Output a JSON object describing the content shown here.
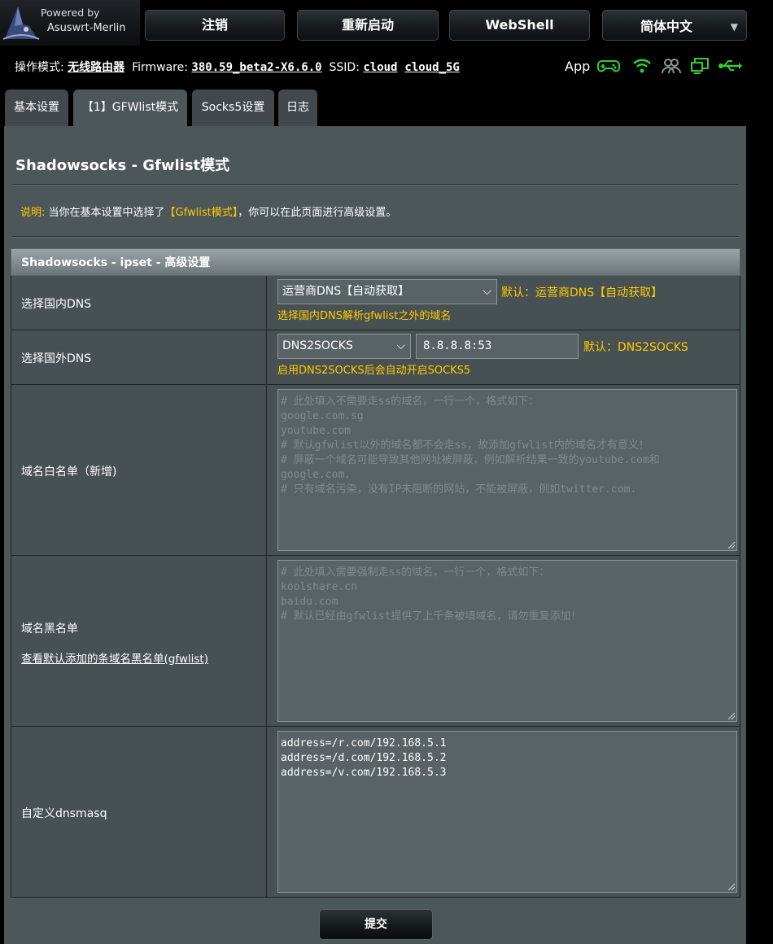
{
  "brand": {
    "powered_by": "Powered by",
    "name": "Asuswrt-Merlin"
  },
  "topbar": {
    "logout": "注销",
    "reboot": "重新启动",
    "webshell": "WebShell",
    "language": "简体中文"
  },
  "status": {
    "mode_label": "操作模式:",
    "mode_value": "无线路由器",
    "firmware_label": "Firmware:",
    "firmware_value": "380.59_beta2-X6.6.0",
    "ssid_label": "SSID:",
    "ssid_1": "cloud",
    "ssid_2": "cloud_5G",
    "app_label": "App",
    "icons": [
      "gamepad-icon",
      "wifi-icon",
      "users-icon",
      "monitor-icon",
      "usb-icon"
    ],
    "icon_color": "#33cc33"
  },
  "tabs": [
    {
      "label": "基本设置"
    },
    {
      "label": "【1】GFWlist模式",
      "active": true
    },
    {
      "label": "Socks5设置"
    },
    {
      "label": "日志"
    }
  ],
  "page": {
    "title": "Shadowsocks - Gfwlist模式",
    "note_label": "说明:",
    "note_pre": "当你在基本设置中选择了",
    "note_highlight": "【Gfwlist模式】",
    "note_post": "，你可以在此页面进行高级设置。"
  },
  "table": {
    "header": "Shadowsocks - ipset - 高级设置",
    "rows": {
      "china_dns": {
        "label": "选择国内DNS",
        "selected": "运营商DNS【自动获取】",
        "default_note": "默认：运营商DNS【自动获取】",
        "hint": "选择国内DNS解析gfwlist之外的域名"
      },
      "foreign_dns": {
        "label": "选择国外DNS",
        "selected": "DNS2SOCKS",
        "server": "8.8.8.8:53",
        "default_note": "默认：DNS2SOCKS",
        "hint": "启用DNS2SOCKS后会自动开启SOCKS5"
      },
      "whitelist": {
        "label": "域名白名单（新增)",
        "placeholder": "# 此处填入不需要走ss的域名，一行一个，格式如下：\ngoogle.com.sg\nyoutube.com\n# 默认gfwlist以外的域名都不会走ss，故添加gfwlist内的域名才有意义！\n# 屏蔽一个域名可能导致其他网址被屏蔽，例如解析结果一致的youtube.com和\ngoogle.com.\n# 只有域名污染，没有IP未阻断的网站，不能被屏蔽，例如twitter.com."
      },
      "blacklist": {
        "label": "域名黑名单",
        "link": "查看默认添加的条域名黑名单(gfwlist)",
        "placeholder": "# 此处填入需要强制走ss的域名，一行一个，格式如下：\nkoolshare.cn\nbaidu.com\n# 默认已经由gfwlist提供了上千条被墙域名，请勿重复添加！"
      },
      "dnsmasq": {
        "label": "自定义dnsmasq",
        "value": "address=/r.com/192.168.5.1\naddress=/d.com/192.168.5.2\naddress=/v.com/192.168.5.3"
      }
    }
  },
  "submit": "提交"
}
